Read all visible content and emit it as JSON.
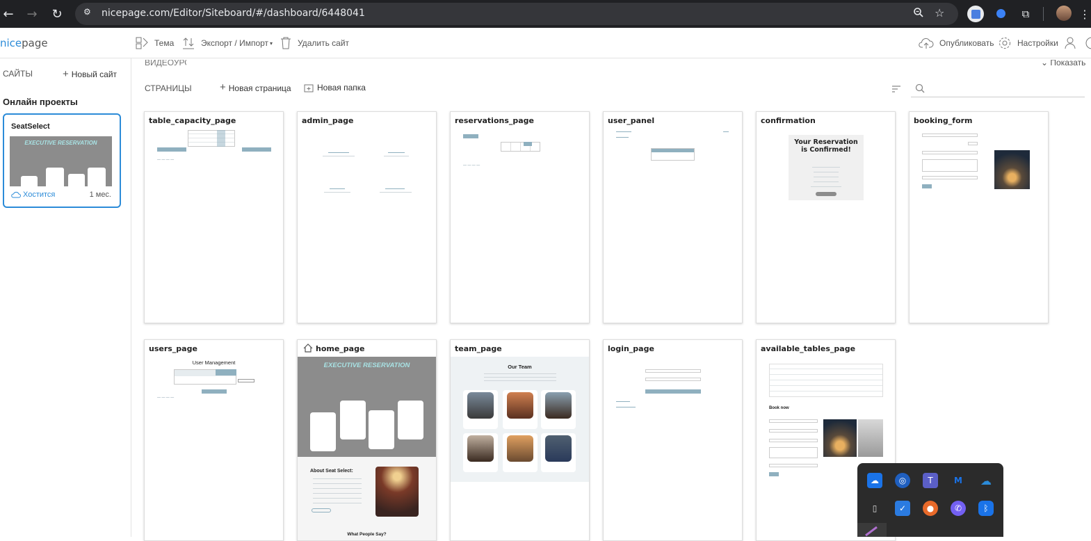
{
  "browser": {
    "url": "nicepage.com/Editor/Siteboard/#/dashboard/6448041",
    "back_icon": "←",
    "forward_icon": "→",
    "reload_icon": "↻"
  },
  "app": {
    "logo_a": "nice",
    "logo_b": "page",
    "toolbar": {
      "theme": "Тема",
      "export_import": "Экспорт / Импорт",
      "delete_site": "Удалить сайт",
      "publish": "Опубликовать",
      "settings": "Настройки"
    }
  },
  "sidebar": {
    "sites_label": "САЙТЫ",
    "new_site": "Новый сайт",
    "online_projects": "Онлайн проекты",
    "site": {
      "name": "SeatSelect",
      "thumb_heading": "EXECUTIVE RESERVATION",
      "status": "Хостится",
      "age": "1 мес."
    }
  },
  "main": {
    "video_tutorials": "ВИДЕОУРОКИ",
    "show": "Показать",
    "pages_label": "СТРАНИЦЫ",
    "new_page": "Новая страница",
    "new_folder": "Новая папка",
    "search_placeholder": ""
  },
  "pages": [
    {
      "title": "table_capacity_page"
    },
    {
      "title": "admin_page"
    },
    {
      "title": "reservations_page"
    },
    {
      "title": "user_panel"
    },
    {
      "title": "confirmation",
      "heading": "Your Reservation is Confirmed!"
    },
    {
      "title": "booking_form"
    },
    {
      "title": "users_page",
      "heading": "User Management"
    },
    {
      "title": "home_page",
      "heading": "EXECUTIVE RESERVATION",
      "about": "About Seat Select:",
      "testimonials": "What People Say?"
    },
    {
      "title": "team_page",
      "heading": "Our Team"
    },
    {
      "title": "login_page"
    },
    {
      "title": "available_tables_page",
      "book_now": "Book now"
    }
  ],
  "colors": {
    "accent": "#2b8bd8",
    "thumb_button": "#8fb0bf",
    "hero_gray": "#8c8c8c",
    "hero_title": "#a8e3e5",
    "browser_dark": "#202124"
  }
}
